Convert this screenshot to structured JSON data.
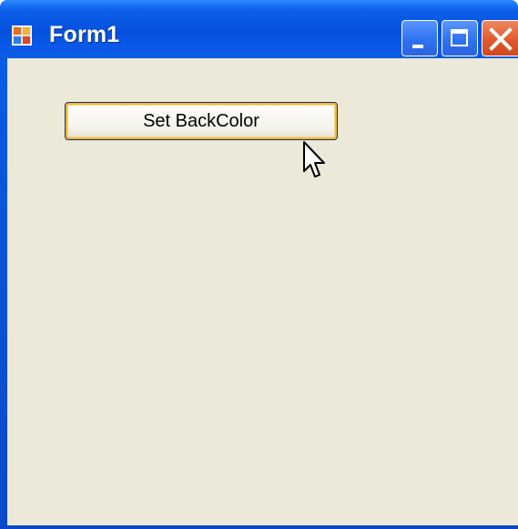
{
  "window": {
    "title": "Form1",
    "caption_buttons": {
      "minimize_icon": "minimize-icon",
      "maximize_icon": "maximize-icon",
      "close_icon": "close-icon"
    }
  },
  "form": {
    "button_label": "Set BackColor"
  },
  "colors": {
    "titlebar": "#0651de",
    "client_background": "#ece9d8",
    "button_hover_border": "#f8b334",
    "close_button": "#e05a2f"
  }
}
